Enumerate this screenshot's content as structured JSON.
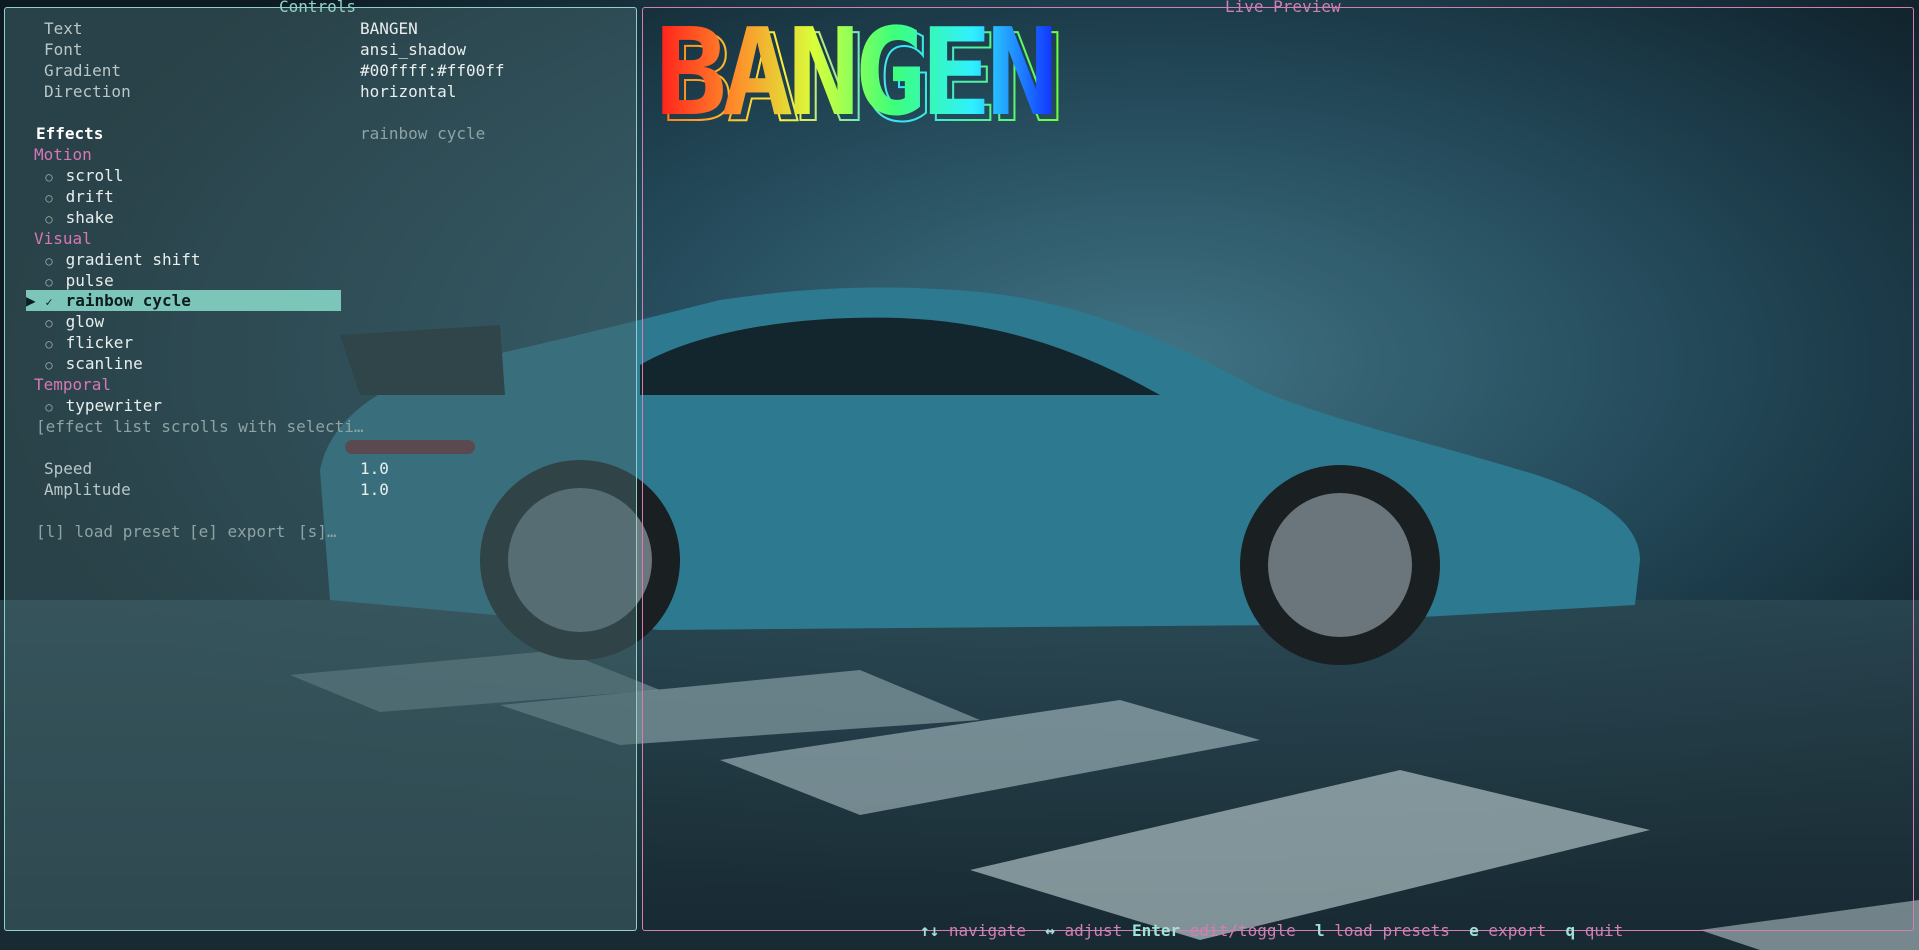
{
  "controls": {
    "title": "Controls",
    "fields": [
      {
        "label": "Text",
        "value": "BANGEN"
      },
      {
        "label": "Font",
        "value": "ansi_shadow"
      },
      {
        "label": "Gradient",
        "value": "#00ffff:#ff00ff"
      },
      {
        "label": "Direction",
        "value": "horizontal"
      }
    ],
    "effects_header": "Effects",
    "effects_value": "rainbow cycle",
    "categories": {
      "motion": "Motion",
      "visual": "Visual",
      "temporal": "Temporal"
    },
    "motion_items": [
      "scroll",
      "drift",
      "shake"
    ],
    "visual_items": [
      "gradient shift",
      "pulse",
      "rainbow cycle",
      "glow",
      "flicker",
      "scanline"
    ],
    "temporal_items": [
      "typewriter"
    ],
    "scroll_hint": "[effect list scrolls with selecti…",
    "selected_marker": "▶",
    "check_mark": "✓",
    "radio_mark": "○",
    "params": [
      {
        "label": "Speed",
        "value": "1.0"
      },
      {
        "label": "Amplitude",
        "value": "1.0"
      }
    ],
    "actions": {
      "load": "[l] load preset",
      "export": "[e] export",
      "save": "[s]…"
    }
  },
  "preview": {
    "title": "Live Preview",
    "banner_text": "BANGEN"
  },
  "footer": {
    "navigate_key": "↑↓",
    "navigate": "navigate",
    "adjust_key": "↔",
    "adjust": "adjust",
    "enter_key": "Enter",
    "enter": "edit/toggle",
    "load_key": "l",
    "load": "load presets",
    "export_key": "e",
    "export": "export",
    "quit_key": "q",
    "quit": "quit"
  },
  "colors": {
    "controls_border": "#8fd1c9",
    "preview_border": "#d27fb3",
    "category": "#d777b5",
    "selection": "#7cc5b9",
    "gradient_start": "#ff1b1b",
    "gradient_end": "#1236ff"
  }
}
